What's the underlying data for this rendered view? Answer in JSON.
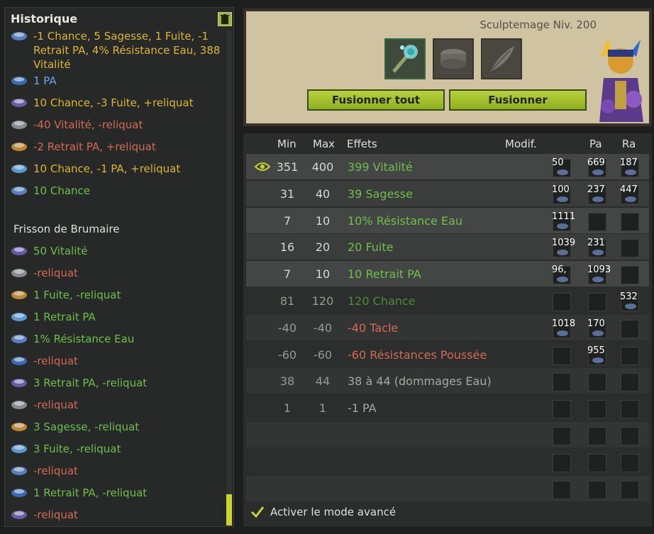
{
  "history": {
    "title": "Historique",
    "entries_top": [
      {
        "icon": "rune-icon",
        "text": "-1 Chance, 5 Sagesse, 1 Fuite, -1 Retrait PA, 4% Résistance Eau, 388 Vitalité",
        "color": "yellow"
      },
      {
        "icon": "rune-pa-icon",
        "text": "1 PA",
        "color": "blue"
      },
      {
        "icon": "rune-icon",
        "text": "10 Chance, -3 Fuite, +reliquat",
        "color": "yellow"
      },
      {
        "icon": "rune-icon",
        "text": "-40 Vitalité, -reliquat",
        "color": "red"
      },
      {
        "icon": "rune-icon",
        "text": "-2 Retrait PA, +reliquat",
        "color": "red"
      },
      {
        "icon": "rune-icon",
        "text": "10 Chance, -1 PA, +reliquat",
        "color": "yellow"
      },
      {
        "icon": "rune-icon",
        "text": "10 Chance",
        "color": "green"
      }
    ],
    "group_title": "Frisson de Brumaire",
    "entries_group": [
      {
        "icon": "rune-icon",
        "text": "50 Vitalité",
        "color": "green"
      },
      {
        "icon": "rune-icon",
        "text": "-reliquat",
        "color": "red"
      },
      {
        "icon": "rune-icon",
        "text": "1 Fuite, -reliquat",
        "color": "green"
      },
      {
        "icon": "rune-icon",
        "text": "1 Retrait PA",
        "color": "green"
      },
      {
        "icon": "rune-icon",
        "text": "1% Résistance Eau",
        "color": "green"
      },
      {
        "icon": "rune-icon",
        "text": "-reliquat",
        "color": "red"
      },
      {
        "icon": "rune-icon",
        "text": "3 Retrait PA, -reliquat",
        "color": "green"
      },
      {
        "icon": "rune-icon",
        "text": "-reliquat",
        "color": "red"
      },
      {
        "icon": "rune-icon",
        "text": "3 Sagesse, -reliquat",
        "color": "green"
      },
      {
        "icon": "rune-icon",
        "text": "3 Fuite, -reliquat",
        "color": "green"
      },
      {
        "icon": "rune-icon",
        "text": "-reliquat",
        "color": "red"
      },
      {
        "icon": "rune-icon",
        "text": "1 Retrait PA, -reliquat",
        "color": "green"
      },
      {
        "icon": "rune-icon",
        "text": "-reliquat",
        "color": "red"
      }
    ]
  },
  "rune_panel": {
    "level": "Sculptemage Niv. 200",
    "fuse_all_label": "Fusionner tout",
    "fuse_label": "Fusionner",
    "slots": [
      "staff-item-icon",
      "rune-slot-icon",
      "feather-icon"
    ]
  },
  "table": {
    "headers": {
      "min": "Min",
      "max": "Max",
      "effects": "Effets",
      "modif": "Modif.",
      "pa": "Pa",
      "ra": "Ra"
    },
    "rows": [
      {
        "min": "351",
        "max": "400",
        "effect": "399 Vitalité",
        "color": "green",
        "bonus": [
          "50",
          "669",
          "187"
        ],
        "eye": true,
        "bg": "light"
      },
      {
        "min": "31",
        "max": "40",
        "effect": "39 Sagesse",
        "color": "green",
        "bonus": [
          "100",
          "237",
          "447"
        ],
        "bg": "light"
      },
      {
        "min": "7",
        "max": "10",
        "effect": "10% Résistance Eau",
        "color": "green",
        "bonus": [
          "1111",
          "",
          ""
        ],
        "bg": "light"
      },
      {
        "min": "16",
        "max": "20",
        "effect": "20 Fuite",
        "color": "green",
        "bonus": [
          "1039",
          "231",
          ""
        ],
        "bg": "light"
      },
      {
        "min": "7",
        "max": "10",
        "effect": "10 Retrait PA",
        "color": "green",
        "bonus": [
          "96,",
          "1093",
          ""
        ],
        "bg": "light"
      },
      {
        "min": "81",
        "max": "120",
        "effect": "120 Chance",
        "color": "dimgreen",
        "bonus": [
          "",
          "",
          "532"
        ],
        "bg": "dark"
      },
      {
        "min": "-40",
        "max": "-40",
        "effect": "-40 Tacle",
        "color": "red",
        "bonus": [
          "1018",
          "170",
          ""
        ],
        "bg": "dark"
      },
      {
        "min": "-60",
        "max": "-60",
        "effect": "-60 Résistances Poussée",
        "color": "red",
        "bonus": [
          "",
          "955",
          ""
        ],
        "bg": "dark"
      },
      {
        "min": "38",
        "max": "44",
        "effect": "38 à 44 (dommages Eau)",
        "color": "grey",
        "bonus": [
          "",
          "",
          ""
        ],
        "bg": "dark"
      },
      {
        "min": "1",
        "max": "1",
        "effect": "-1 PA",
        "color": "grey",
        "bonus": [
          "",
          "",
          ""
        ],
        "bg": "dark"
      },
      {
        "min": "",
        "max": "",
        "effect": "",
        "color": "grey",
        "bonus": [
          "",
          "",
          ""
        ],
        "bg": "dark"
      },
      {
        "min": "",
        "max": "",
        "effect": "",
        "color": "grey",
        "bonus": [
          "",
          "",
          ""
        ],
        "bg": "dark"
      },
      {
        "min": "",
        "max": "",
        "effect": "",
        "color": "grey",
        "bonus": [
          "",
          "",
          ""
        ],
        "bg": "dark"
      }
    ],
    "advanced_label": "Activer le mode avancé"
  },
  "colors": {
    "yellow": "#e0b62a",
    "green": "#6fbf4a",
    "red": "#d46a54",
    "blue": "#6aa8e0",
    "dimgreen": "#4f8a35",
    "grey": "#a8a8a0",
    "accent": "#9bb33a"
  }
}
